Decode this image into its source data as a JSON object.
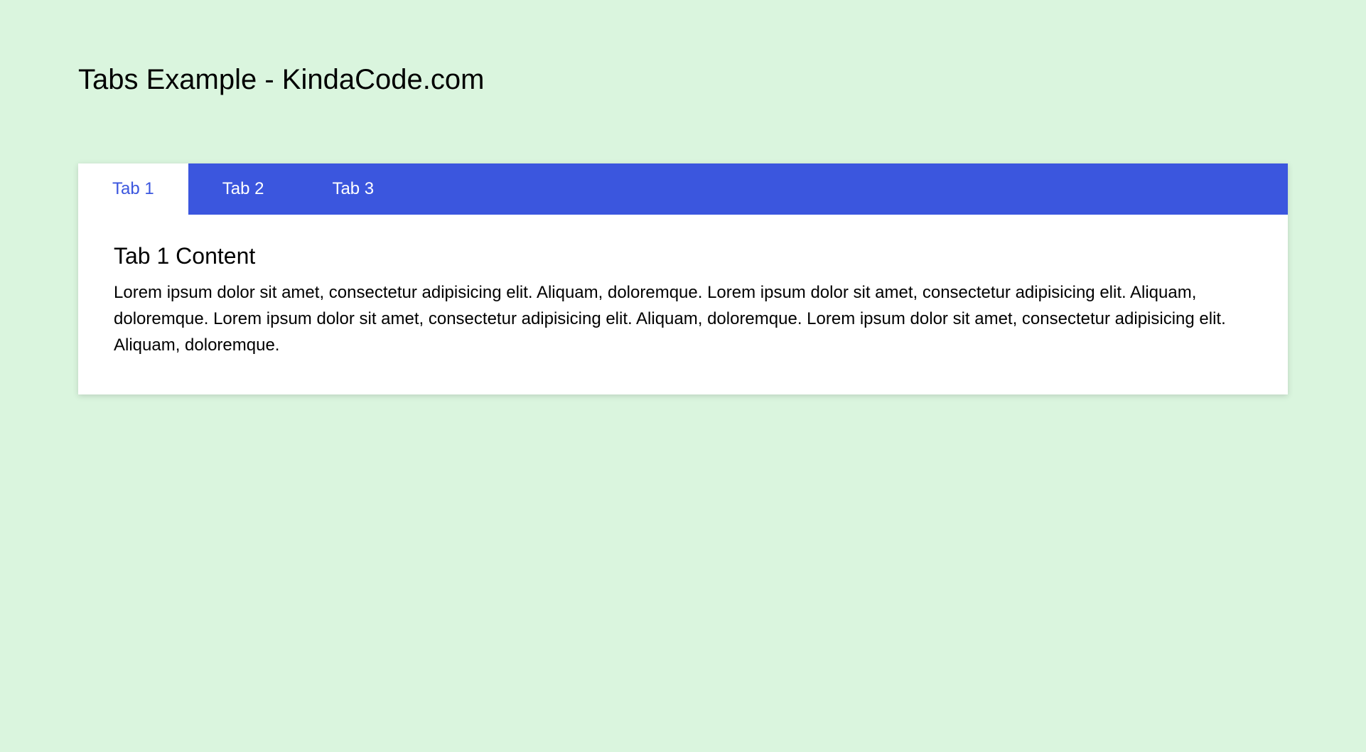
{
  "pageTitle": "Tabs Example - KindaCode.com",
  "tabs": [
    {
      "label": "Tab 1",
      "active": true
    },
    {
      "label": "Tab 2",
      "active": false
    },
    {
      "label": "Tab 3",
      "active": false
    }
  ],
  "content": {
    "heading": "Tab 1 Content",
    "body": "Lorem ipsum dolor sit amet, consectetur adipisicing elit. Aliquam, doloremque. Lorem ipsum dolor sit amet, consectetur adipisicing elit. Aliquam, doloremque. Lorem ipsum dolor sit amet, consectetur adipisicing elit. Aliquam, doloremque. Lorem ipsum dolor sit amet, consectetur adipisicing elit. Aliquam, doloremque."
  }
}
